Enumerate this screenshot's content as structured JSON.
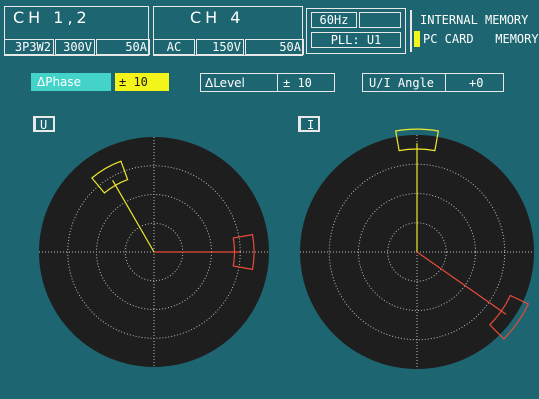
{
  "header": {
    "ch12": {
      "title": "CH  1,2",
      "wiring": "3P3W2",
      "voltage": "300V",
      "current": "50A"
    },
    "ch4": {
      "title": "CH  4",
      "coupling": "AC",
      "voltage": "150V",
      "current": "50A"
    },
    "freq": "60Hz",
    "pll": "PLL: U1",
    "memory": [
      "INTERNAL MEMORY",
      "PC CARD   MEMORY"
    ]
  },
  "controls": {
    "delta_phase": {
      "label": "ΔPhase",
      "value": "± 10"
    },
    "delta_level": {
      "label": "ΔLevel",
      "value": "± 10"
    },
    "ui_angle": {
      "label": "U/I Angle",
      "value": "+0"
    }
  },
  "panels": {
    "u": {
      "label": "U"
    },
    "i": {
      "label": "I"
    }
  },
  "colors": {
    "background": "#1d6570",
    "dial": "#1e1e1e",
    "phase_yellow": "#f0e830",
    "phase_red": "#e84a3a",
    "highlight": "#f3f51a",
    "button": "#43d3c9"
  },
  "vectors": {
    "u": [
      {
        "color": "yellow",
        "angle_deg": 120,
        "magnitude": 0.72
      },
      {
        "color": "red",
        "angle_deg": 0,
        "magnitude": 0.75
      }
    ],
    "i": [
      {
        "color": "yellow",
        "angle_deg": 90,
        "magnitude": 0.93
      },
      {
        "color": "red",
        "angle_deg": -35,
        "magnitude": 0.93
      }
    ]
  }
}
